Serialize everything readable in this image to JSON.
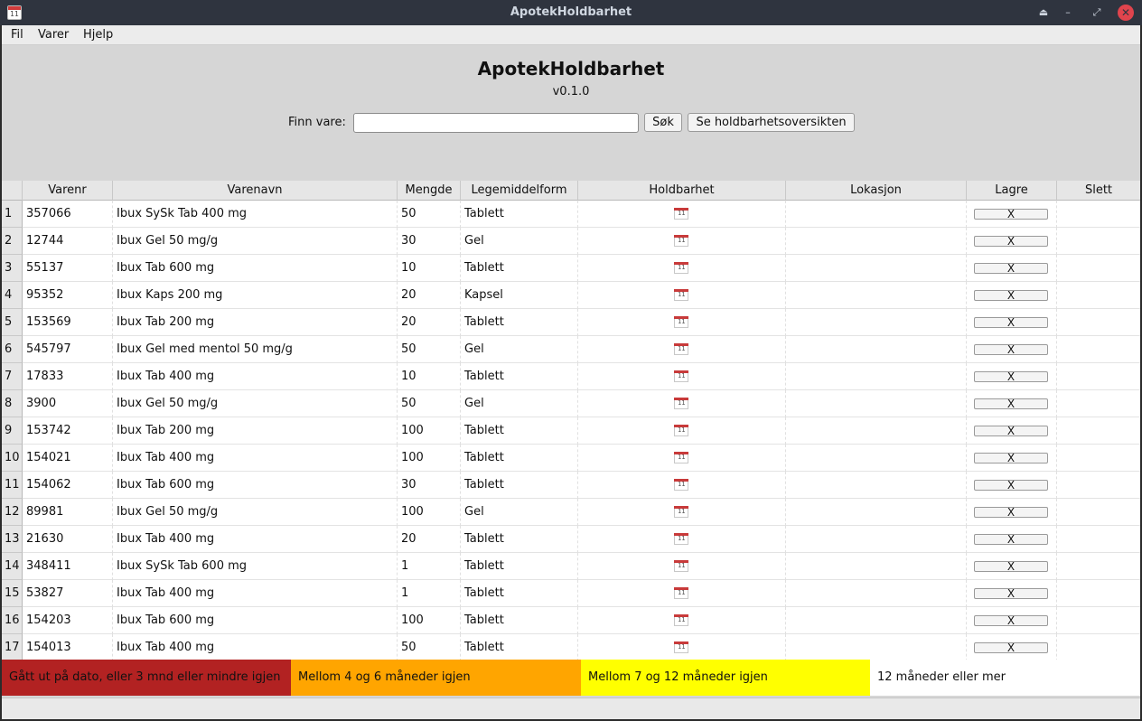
{
  "window": {
    "title": "ApotekHoldbarhet",
    "app_icon_text": "11",
    "controls": {
      "eject": "⏏",
      "minimize": "–",
      "restore": "⤢",
      "close": "✕"
    }
  },
  "menubar": {
    "items": [
      "Fil",
      "Varer",
      "Hjelp"
    ]
  },
  "header": {
    "title": "ApotekHoldbarhet",
    "version": "v0.1.0",
    "search_label": "Finn vare:",
    "search_value": "",
    "search_button": "Søk",
    "overview_button": "Se holdbarhetsoversikten"
  },
  "table": {
    "columns": [
      "Varenr",
      "Varenavn",
      "Mengde",
      "Legemiddelform",
      "Holdbarhet",
      "Lokasjon",
      "Lagre",
      "Slett"
    ],
    "save_label": "X",
    "rows": [
      {
        "n": "1",
        "varenr": "357066",
        "varenavn": "Ibux SySk Tab 400 mg",
        "mengde": "50",
        "form": "Tablett",
        "lokasjon": ""
      },
      {
        "n": "2",
        "varenr": "12744",
        "varenavn": "Ibux Gel 50 mg/g",
        "mengde": "30",
        "form": "Gel",
        "lokasjon": ""
      },
      {
        "n": "3",
        "varenr": "55137",
        "varenavn": "Ibux Tab 600 mg",
        "mengde": "10",
        "form": "Tablett",
        "lokasjon": ""
      },
      {
        "n": "4",
        "varenr": "95352",
        "varenavn": "Ibux Kaps 200 mg",
        "mengde": "20",
        "form": "Kapsel",
        "lokasjon": ""
      },
      {
        "n": "5",
        "varenr": "153569",
        "varenavn": "Ibux Tab 200 mg",
        "mengde": "20",
        "form": "Tablett",
        "lokasjon": ""
      },
      {
        "n": "6",
        "varenr": "545797",
        "varenavn": "Ibux Gel med mentol 50 mg/g",
        "mengde": "50",
        "form": "Gel",
        "lokasjon": ""
      },
      {
        "n": "7",
        "varenr": "17833",
        "varenavn": "Ibux Tab 400 mg",
        "mengde": "10",
        "form": "Tablett",
        "lokasjon": ""
      },
      {
        "n": "8",
        "varenr": "3900",
        "varenavn": "Ibux Gel 50 mg/g",
        "mengde": "50",
        "form": "Gel",
        "lokasjon": ""
      },
      {
        "n": "9",
        "varenr": "153742",
        "varenavn": "Ibux Tab 200 mg",
        "mengde": "100",
        "form": "Tablett",
        "lokasjon": ""
      },
      {
        "n": "10",
        "varenr": "154021",
        "varenavn": "Ibux Tab 400 mg",
        "mengde": "100",
        "form": "Tablett",
        "lokasjon": ""
      },
      {
        "n": "11",
        "varenr": "154062",
        "varenavn": "Ibux Tab 600 mg",
        "mengde": "30",
        "form": "Tablett",
        "lokasjon": ""
      },
      {
        "n": "12",
        "varenr": "89981",
        "varenavn": "Ibux Gel 50 mg/g",
        "mengde": "100",
        "form": "Gel",
        "lokasjon": ""
      },
      {
        "n": "13",
        "varenr": "21630",
        "varenavn": "Ibux Tab 400 mg",
        "mengde": "20",
        "form": "Tablett",
        "lokasjon": ""
      },
      {
        "n": "14",
        "varenr": "348411",
        "varenavn": "Ibux SySk Tab 600 mg",
        "mengde": "1",
        "form": "Tablett",
        "lokasjon": ""
      },
      {
        "n": "15",
        "varenr": "53827",
        "varenavn": "Ibux Tab 400 mg",
        "mengde": "1",
        "form": "Tablett",
        "lokasjon": ""
      },
      {
        "n": "16",
        "varenr": "154203",
        "varenavn": "Ibux Tab 600 mg",
        "mengde": "100",
        "form": "Tablett",
        "lokasjon": ""
      },
      {
        "n": "17",
        "varenr": "154013",
        "varenavn": "Ibux Tab 400 mg",
        "mengde": "50",
        "form": "Tablett",
        "lokasjon": ""
      }
    ]
  },
  "legend": {
    "items": [
      {
        "label": "Gått ut på dato, eller 3 mnd eller mindre igjen",
        "color": "#b22222"
      },
      {
        "label": "Mellom 4 og 6 måneder igjen",
        "color": "#ffa500"
      },
      {
        "label": "Mellom 7 og 12 måneder igjen",
        "color": "#ffff00"
      },
      {
        "label": "12 måneder eller mer",
        "color": "#ffffff"
      }
    ]
  }
}
